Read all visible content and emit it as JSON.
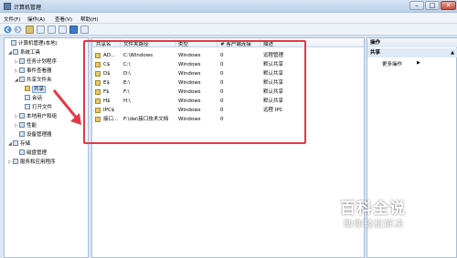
{
  "window": {
    "title": "计算机管理"
  },
  "menu": [
    "文件(F)",
    "操作(A)",
    "查看(V)",
    "帮助(H)"
  ],
  "tree": [
    {
      "label": "计算机管理(本地)",
      "icon": "computer-icon",
      "level": 0,
      "arrow": ""
    },
    {
      "label": "系统工具",
      "icon": "tools-icon",
      "level": 1,
      "arrow": "◢"
    },
    {
      "label": "任务计划程序",
      "icon": "clock-icon",
      "level": 2,
      "arrow": "▷"
    },
    {
      "label": "事件查看器",
      "icon": "event-viewer-icon",
      "level": 2,
      "arrow": "▷"
    },
    {
      "label": "共享文件夹",
      "icon": "shared-folder-icon",
      "level": 2,
      "arrow": "◢"
    },
    {
      "label": "共享",
      "icon": "share-icon",
      "level": 3,
      "arrow": "",
      "selected": true
    },
    {
      "label": "会话",
      "icon": "session-icon",
      "level": 3,
      "arrow": ""
    },
    {
      "label": "打开文件",
      "icon": "open-files-icon",
      "level": 3,
      "arrow": ""
    },
    {
      "label": "本地用户和组",
      "icon": "users-icon",
      "level": 2,
      "arrow": "▷"
    },
    {
      "label": "性能",
      "icon": "performance-icon",
      "level": 2,
      "arrow": "▷"
    },
    {
      "label": "设备管理器",
      "icon": "device-manager-icon",
      "level": 2,
      "arrow": ""
    },
    {
      "label": "存储",
      "icon": "storage-icon",
      "level": 1,
      "arrow": "◢"
    },
    {
      "label": "磁盘管理",
      "icon": "disk-icon",
      "level": 2,
      "arrow": ""
    },
    {
      "label": "服务和应用程序",
      "icon": "services-icon",
      "level": 1,
      "arrow": "▷"
    }
  ],
  "columns": [
    "共享名",
    "文件夹路径",
    "类型",
    "# 客户端连接",
    "描述"
  ],
  "shares": [
    {
      "name": "AD...",
      "path": "C:\\Windows",
      "type": "Windows",
      "clients": "0",
      "desc": "远程管理"
    },
    {
      "name": "C$",
      "path": "C:\\",
      "type": "Windows",
      "clients": "0",
      "desc": "默认共享"
    },
    {
      "name": "D$",
      "path": "D:\\",
      "type": "Windows",
      "clients": "0",
      "desc": "默认共享"
    },
    {
      "name": "E$",
      "path": "E:\\",
      "type": "Windows",
      "clients": "0",
      "desc": "默认共享"
    },
    {
      "name": "F$",
      "path": "F:\\",
      "type": "Windows",
      "clients": "0",
      "desc": "默认共享"
    },
    {
      "name": "H$",
      "path": "H:\\",
      "type": "Windows",
      "clients": "0",
      "desc": "默认共享"
    },
    {
      "name": "IPC$",
      "path": "",
      "type": "Windows",
      "clients": "0",
      "desc": "远程 IPC"
    },
    {
      "name": "接口...",
      "path": "F:\\dw\\接口技术文档",
      "type": "Windows",
      "clients": "0",
      "desc": ""
    }
  ],
  "actions": {
    "header": "操作",
    "section": "共享",
    "more": "更多操作"
  },
  "watermark": {
    "big": "百科全说",
    "small": "助你轻松解决"
  },
  "colors": {
    "highlight": "#e03b45"
  }
}
